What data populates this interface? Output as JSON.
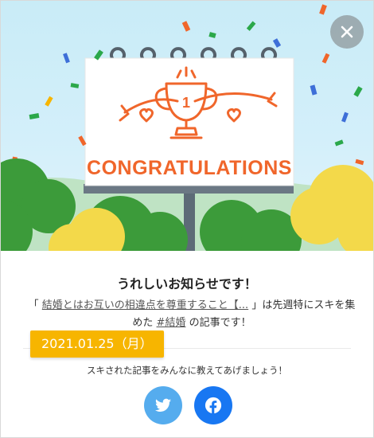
{
  "hero": {
    "banner_text": "CONGRATULATIONS",
    "trophy_number": "1"
  },
  "modal": {
    "title": "うれしいお知らせです！",
    "message_prefix": "「",
    "article_link": "結婚とはお互いの相違点を尊重すること【...",
    "message_mid": "」は先週特にスキを集めた",
    "hashtag_link": "#結婚",
    "message_suffix": "の記事です！",
    "date_badge": "2021.01.25（月）",
    "share_prompt": "スキされた記事をみんなに教えてあげましょう！"
  },
  "icons": {
    "close": "close-icon",
    "twitter": "twitter-icon",
    "facebook": "facebook-icon"
  },
  "colors": {
    "accent_orange": "#f0662b",
    "badge": "#f7b500",
    "twitter": "#55acee",
    "facebook": "#1877f2"
  }
}
